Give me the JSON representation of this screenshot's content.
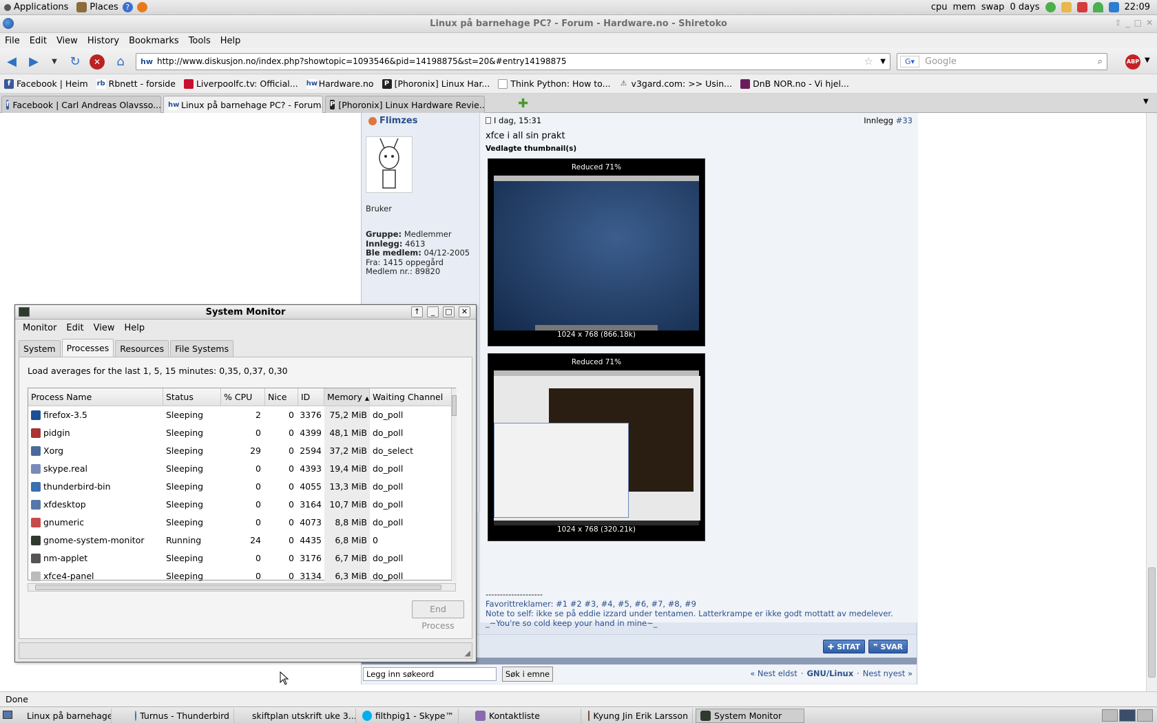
{
  "top_panel": {
    "applications": "Applications",
    "places": "Places",
    "tray": {
      "cpu": "cpu",
      "mem": "mem",
      "swap": "swap",
      "uptime": "0 days",
      "clock": "22:09"
    }
  },
  "browser": {
    "title": "Linux på barnehage PC? - Forum - Hardware.no - Shiretoko",
    "menu": [
      "File",
      "Edit",
      "View",
      "History",
      "Bookmarks",
      "Tools",
      "Help"
    ],
    "url": "http://www.diskusjon.no/index.php?showtopic=1093546&pid=14198875&st=20&#entry14198875",
    "search_placeholder": "Google",
    "bookmarks": [
      "Facebook | Heim",
      "Rbnett - forside",
      "Liverpoolfc.tv: Official...",
      "Hardware.no",
      "[Phoronix] Linux Har...",
      "Think Python: How to...",
      "v3gard.com: >> Usin...",
      "DnB NOR.no - Vi hjel..."
    ],
    "tabs": [
      "Facebook | Carl Andreas Olavsso...",
      "Linux på barnehage PC? - Forum...",
      "[Phoronix] Linux Hardware Revie..."
    ],
    "status": "Done"
  },
  "post": {
    "author": "Flimzes",
    "date": "I dag, 15:31",
    "post_label": "Innlegg",
    "post_num": "#33",
    "rank": "Bruker",
    "group_label": "Gruppe:",
    "group": "Medlemmer",
    "posts_label": "Innlegg:",
    "posts": "4613",
    "joined_label": "Ble medlem:",
    "joined": "04/12-2005",
    "from": "Fra: 1415 oppegård",
    "member_nr": "Medlem nr.: 89820",
    "text": "xfce i all sin prakt",
    "attached": "Vedlagte thumbnail(s)",
    "thumbs": [
      {
        "label": "Reduced 71%",
        "caption": "1024 x 768 (866.18k)"
      },
      {
        "label": "Reduced 71%",
        "caption": "1024 x 768 (320.21k)"
      }
    ],
    "sig_sep": "--------------------",
    "sig_fav": "Favorittreklamer: #1 #2 #3, #4, #5, #6, #7, #8, #9",
    "sig_note": "Note to self: ikke se på eddie izzard under tentamen. Latterkrampe er ikke godt mottatt av medelever.",
    "sig_quote": "_~You're so cold keep your hand in mine~_",
    "quote_btn": "SITAT",
    "reply_btn": "SVAR",
    "search_value": "Legg inn søkeord",
    "search_btn": "Søk i emne",
    "nav": {
      "prev": "« Nest eldst",
      "sep": "·",
      "forum": "GNU/Linux",
      "next": "Nest nyest »"
    }
  },
  "sysmon": {
    "title": "System Monitor",
    "menu": [
      "Monitor",
      "Edit",
      "View",
      "Help"
    ],
    "tabs": [
      "System",
      "Processes",
      "Resources",
      "File Systems"
    ],
    "load": "Load averages for the last 1, 5, 15 minutes: 0,35, 0,37, 0,30",
    "columns": [
      "Process Name",
      "Status",
      "% CPU",
      "Nice",
      "ID",
      "Memory",
      "Waiting Channel"
    ],
    "rows": [
      {
        "name": "firefox-3.5",
        "status": "Sleeping",
        "cpu": "2",
        "nice": "0",
        "id": "3376",
        "mem": "75,2 MiB",
        "wchan": "do_poll"
      },
      {
        "name": "pidgin",
        "status": "Sleeping",
        "cpu": "0",
        "nice": "0",
        "id": "4399",
        "mem": "48,1 MiB",
        "wchan": "do_poll"
      },
      {
        "name": "Xorg",
        "status": "Sleeping",
        "cpu": "29",
        "nice": "0",
        "id": "2594",
        "mem": "37,2 MiB",
        "wchan": "do_select"
      },
      {
        "name": "skype.real",
        "status": "Sleeping",
        "cpu": "0",
        "nice": "0",
        "id": "4393",
        "mem": "19,4 MiB",
        "wchan": "do_poll"
      },
      {
        "name": "thunderbird-bin",
        "status": "Sleeping",
        "cpu": "0",
        "nice": "0",
        "id": "4055",
        "mem": "13,3 MiB",
        "wchan": "do_poll"
      },
      {
        "name": "xfdesktop",
        "status": "Sleeping",
        "cpu": "0",
        "nice": "0",
        "id": "3164",
        "mem": "10,7 MiB",
        "wchan": "do_poll"
      },
      {
        "name": "gnumeric",
        "status": "Sleeping",
        "cpu": "0",
        "nice": "0",
        "id": "4073",
        "mem": "8,8 MiB",
        "wchan": "do_poll"
      },
      {
        "name": "gnome-system-monitor",
        "status": "Running",
        "cpu": "24",
        "nice": "0",
        "id": "4435",
        "mem": "6,8 MiB",
        "wchan": "0"
      },
      {
        "name": "nm-applet",
        "status": "Sleeping",
        "cpu": "0",
        "nice": "0",
        "id": "3176",
        "mem": "6,7 MiB",
        "wchan": "do_poll"
      },
      {
        "name": "xfce4-panel",
        "status": "Sleeping",
        "cpu": "0",
        "nice": "0",
        "id": "3134",
        "mem": "6,3 MiB",
        "wchan": "do_poll"
      }
    ],
    "end_process": "End Process"
  },
  "taskbar": [
    "Linux på barnehage ...",
    "Turnus - Thunderbird",
    "skiftplan utskrift uke 3...",
    "filthpig1 - Skype™",
    "Kontaktliste",
    "Kyung Jin Erik Larsson",
    "System Monitor"
  ],
  "colors": {
    "accent": "#2f72c4",
    "forum_link": "#2c4f8c",
    "close_red": "#dd2222"
  }
}
